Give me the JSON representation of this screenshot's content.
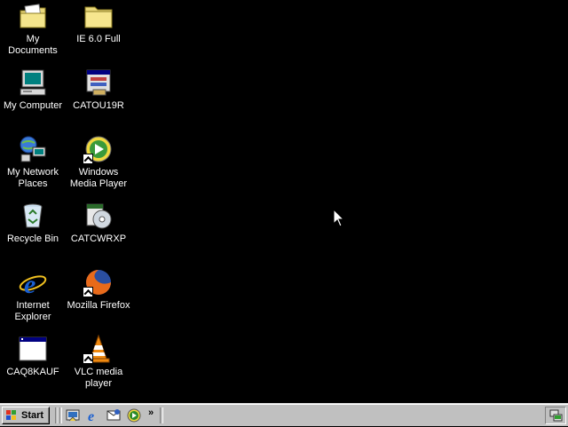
{
  "desktop": {
    "icons": [
      {
        "label": "My Documents",
        "icon": "my-documents-icon"
      },
      {
        "label": "IE 6.0 Full",
        "icon": "folder-icon"
      },
      {
        "label": "My Computer",
        "icon": "my-computer-icon"
      },
      {
        "label": "CATOU19R",
        "icon": "application-window-icon"
      },
      {
        "label": "My Network Places",
        "icon": "network-places-icon"
      },
      {
        "label": "Windows Media Player",
        "icon": "media-player-icon"
      },
      {
        "label": "Recycle Bin",
        "icon": "recycle-bin-icon"
      },
      {
        "label": "CATCWRXP",
        "icon": "cd-installer-icon"
      },
      {
        "label": "Internet Explorer",
        "icon": "internet-explorer-icon"
      },
      {
        "label": "Mozilla Firefox",
        "icon": "firefox-icon"
      },
      {
        "label": "CAQ8KAUF",
        "icon": "blank-window-icon"
      },
      {
        "label": "VLC media player",
        "icon": "vlc-cone-icon"
      }
    ]
  },
  "taskbar": {
    "start_label": "Start",
    "quick_launch": [
      "show-desktop-icon",
      "internet-explorer-icon",
      "outlook-express-icon",
      "media-player-icon"
    ],
    "chevron": "»",
    "tray": [
      "network-tray-icon"
    ]
  },
  "colors": {
    "desktop": "#000000",
    "taskbar": "#c0c0c0",
    "label": "#ffffff"
  }
}
